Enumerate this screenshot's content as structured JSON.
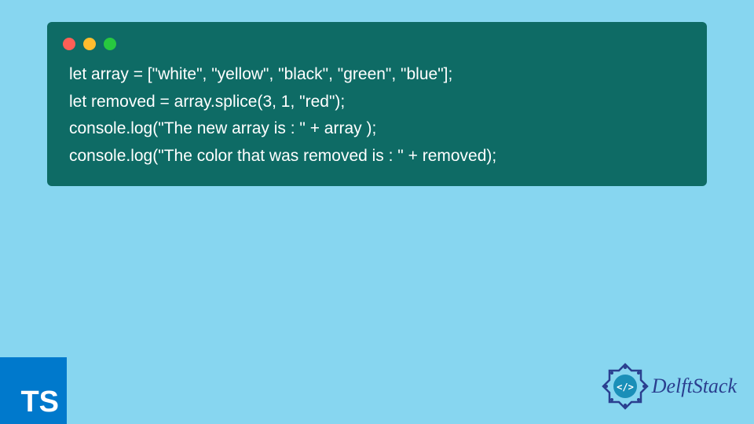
{
  "code": {
    "line1": "let array = [\"white\", \"yellow\", \"black\", \"green\", \"blue\"];",
    "line2": "let removed = array.splice(3, 1, \"red\");",
    "line3": "console.log(\"The new array is : \" + array );",
    "line4": "console.log(\"The color that was removed is : \" + removed);"
  },
  "badge": {
    "ts": "TS"
  },
  "brand": {
    "name": "DelftStack"
  },
  "colors": {
    "background": "#87d6f0",
    "codeWindow": "#0e6b65",
    "tsBadge": "#0079cc",
    "brandText": "#2a3f8f"
  }
}
